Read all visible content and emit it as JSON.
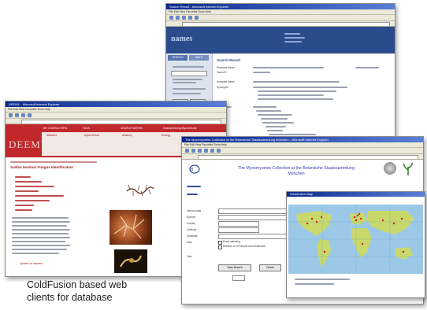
{
  "caption": {
    "line1": "ColdFusion based web",
    "line2": "clients for database"
  },
  "window_names": {
    "title": "Search Result - Microsoft Internet Explorer",
    "menu": "File   Edit   View   Favorites   Tools   Help",
    "logo": "names",
    "tab_search": "SEARCH",
    "tab_help": "HELP",
    "result_heading": "Search Result",
    "labels": [
      "Preferred Name",
      "Taxon ID",
      "Accepted Name",
      "Synonyms",
      "Classification"
    ]
  },
  "window_deemy": {
    "title": "DEEMY - Microsoft Internet Explorer",
    "menu": "File   Edit   View   Favorites   Tools   Help",
    "logo": "DEEMY",
    "nav": [
      "MY CHARACTERS",
      "TAXA",
      "SEARCH WITHIN",
      "Characterizing Mycorrhizae"
    ],
    "subnav": [
      "Attributes",
      "Alpha Search",
      "Anatomy",
      "Ecology"
    ],
    "heading": "Suillus bovinus Fungus Identification",
    "footer": "Update on request"
  },
  "window_myco": {
    "title": "The Myxomycetes Collection at the Botanische Staatssammlung München - Microsoft Internet Explorer",
    "menu": "File   Edit   View   Favorites   Tools   Help",
    "header_line1": "The Myxomycetes Collection at the Botanische Staatssammlung",
    "header_line2": "München",
    "labels": [
      "Genus name",
      "Species",
      "Country",
      "Collector",
      "Substrate",
      "Date",
      "Year"
    ],
    "btn_search": "Start Search",
    "btn_reset": "Reset",
    "checkbox1": "Exact matching",
    "checkbox2": "Retrieve on in Results and Distribution"
  },
  "map": {
    "title": "Distribution Map",
    "land_color": "#c8d86a",
    "sea_color": "#9cc8e8",
    "marker_color": "#d02020"
  }
}
